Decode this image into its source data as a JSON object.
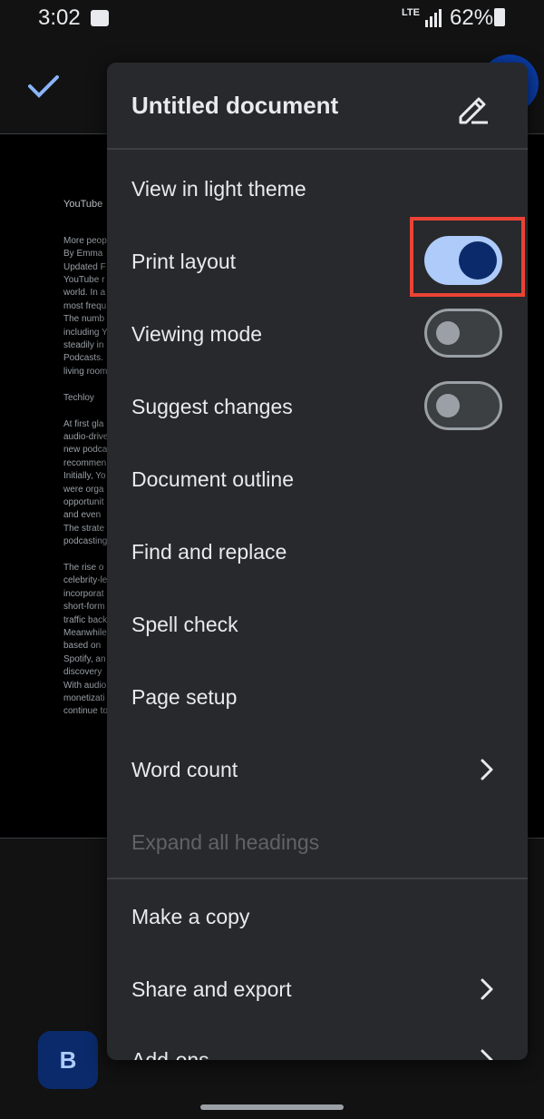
{
  "status_bar": {
    "time": "3:02",
    "network": "LTE",
    "battery": "62%"
  },
  "document": {
    "lines": [
      "YouTube",
      "",
      "More peop",
      "By Emma",
      "Updated F",
      "YouTube r",
      "world. In a",
      "most frequ",
      "The numb",
      "including Y",
      "steadily in",
      "Podcasts.",
      "living room",
      "",
      "Techloy",
      "",
      "At first gla",
      "audio-drive",
      "new podca",
      "recommen",
      "Initially, Yo",
      "were orga",
      "opportunit",
      "and even",
      "The strate",
      "podcasting",
      "",
      "The rise o",
      "celebrity-le",
      "incorporat",
      "short-form",
      "traffic back",
      "Meanwhile",
      "based on",
      "Spotify, an",
      "discovery",
      "With audio",
      "monetizati",
      "continue to"
    ]
  },
  "menu": {
    "title": "Untitled document",
    "items": [
      {
        "label": "View in light theme"
      },
      {
        "label": "Print layout",
        "toggle": true
      },
      {
        "label": "Viewing mode",
        "toggle": false
      },
      {
        "label": "Suggest changes",
        "toggle": false
      },
      {
        "label": "Document outline"
      },
      {
        "label": "Find and replace"
      },
      {
        "label": "Spell check"
      },
      {
        "label": "Page setup"
      },
      {
        "label": "Word count",
        "submenu": true
      },
      {
        "label": "Expand all headings",
        "disabled": true
      },
      {
        "label": "Make a copy"
      },
      {
        "label": "Share and export",
        "submenu": true
      },
      {
        "label": "Add-ons",
        "submenu": true
      }
    ]
  },
  "toolbar": {
    "bold_label": "B"
  },
  "colors": {
    "accent": "#aecbfa",
    "highlight": "#ea4335",
    "menu_bg": "#28292c"
  }
}
